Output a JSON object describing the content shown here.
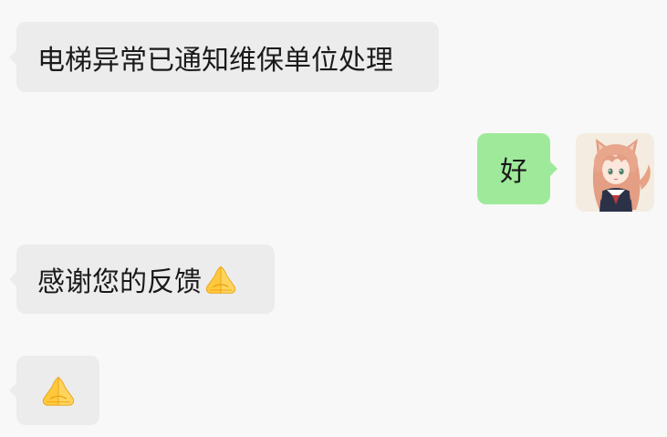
{
  "chat": {
    "messages": [
      {
        "direction": "incoming",
        "text": "电梯异常已通知维保单位处理",
        "emoji": ""
      },
      {
        "direction": "outgoing",
        "text": "好",
        "emoji": ""
      },
      {
        "direction": "incoming",
        "text": "感谢您的反馈",
        "emoji": "folded-hands-icon"
      },
      {
        "direction": "incoming",
        "text": "",
        "emoji": "folded-hands-icon"
      }
    ],
    "avatar": {
      "icon": "anime-cat-girl-avatar",
      "background": "#f4ece0"
    }
  },
  "colors": {
    "background": "#f8f8f8",
    "incoming_bubble": "#ececed",
    "outgoing_bubble": "#9eea9a",
    "text": "#1a1a1a"
  }
}
